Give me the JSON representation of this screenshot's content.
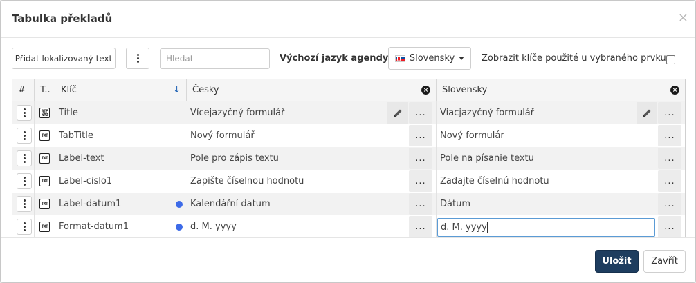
{
  "dialog": {
    "title": "Tabulka překladů",
    "close_icon": "close-icon"
  },
  "toolbar": {
    "add_label": "Přidat lokalizovaný text",
    "search_placeholder": "Hledat",
    "agenda_label": "Výchozí jazyk agendy",
    "language_selected": "Slovensky",
    "show_keys_label": "Zobrazit klíče použité u vybraného prvku",
    "show_keys_checked": false
  },
  "grid": {
    "columns": {
      "index": "#",
      "type": "T..",
      "key": "Klíč",
      "lang1": "Česky",
      "lang2": "Slovensky"
    },
    "rows": [
      {
        "type": "RTF",
        "key": "Title",
        "cs": "Vícejazyčný formulář",
        "sk": "Viacjazyčný formulář",
        "dot": false
      },
      {
        "type": "TXT",
        "key": "TabTitle",
        "cs": "Nový formulář",
        "sk": "Nový formulár",
        "dot": false
      },
      {
        "type": "TXT",
        "key": "Label-text",
        "cs": "Pole pro zápis textu",
        "sk": "Pole na písanie textu",
        "dot": false
      },
      {
        "type": "TXT",
        "key": "Label-cislo1",
        "cs": "Zapište číselnou hodnotu",
        "sk": "Zadajte číselnú hodnotu",
        "dot": false
      },
      {
        "type": "TXT",
        "key": "Label-datum1",
        "cs": "Kalendářní datum",
        "sk": "Dátum",
        "dot": true
      },
      {
        "type": "TXT",
        "key": "Format-datum1",
        "cs": "d. M. yyyy",
        "sk": "d. M. yyyy",
        "dot": true
      }
    ],
    "more_label": "...",
    "accent_dot_color": "#3d6be8"
  },
  "footer": {
    "save_label": "Uložit",
    "close_label": "Zavřít",
    "save_color": "#1e3d5f"
  }
}
